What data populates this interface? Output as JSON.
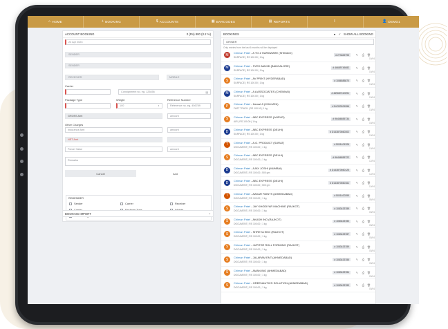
{
  "nav": [
    {
      "icon": "⌂",
      "icon_name": "home-icon",
      "label": "HOME"
    },
    {
      "icon": "+",
      "icon_name": "plus-icon",
      "label": "BOOKING"
    },
    {
      "icon": "$",
      "icon_name": "accounts-icon",
      "label": "ACCOUNTS"
    },
    {
      "icon": "▦",
      "icon_name": "barcode-icon",
      "label": "BARCODES"
    },
    {
      "icon": "▤",
      "icon_name": "reports-icon",
      "label": "REPORTS"
    },
    {
      "icon": "i",
      "icon_name": "info-icon",
      "label": ""
    },
    {
      "icon": "👤",
      "icon_name": "user-icon",
      "label": "DEMO1"
    }
  ],
  "account": {
    "title": "ACCOUNT BOOKING",
    "status": "0 (Rs) 800 (0.2 %)",
    "date": "24 Apr 2023",
    "sender": "SENDER",
    "sender2": "SENDER",
    "receiver": "RECEIVER",
    "mobile": "MOBILE",
    "carrier_label": "Carrier",
    "consignment_ph": "Consignment no. eg. 125456",
    "package_label": "Package Type",
    "weight_label": "Weight",
    "reference_label": "Reference Number",
    "weight_value": "100",
    "reference_ph": "Reference no. eg. 456789",
    "gross_amt": "GROSS Amt",
    "amount_ph": "amount",
    "other_charges": "Other Charges",
    "insurance_ph": "Insurance Amt",
    "net_amt": "NET Amt",
    "parcel_value": "Parcel Value",
    "remarks": "Remarks",
    "cancel": "Cancel",
    "add": "Add",
    "remember": "REMEMBER",
    "chk_sender": "Sender",
    "chk_carrier": "Carrier",
    "chk_receiver": "Receiver",
    "chk_carrier2": "Carrier",
    "chk_package": "Package Type",
    "chk_weight": "Weight",
    "chk_auto": "Auto Consignment",
    "import": "BOOKING IMPORT"
  },
  "bookings": {
    "title": "BOOKINGS",
    "show_all": "SHOW ALL BOOKING",
    "search": "GR/NER",
    "note": "Only entries from the last 6 months will be displayed",
    "rows": [
      {
        "letter": "M",
        "color": "#c0392b",
        "co": "Chiman Patel",
        "name": "A TO Z HARDWARE (SHIMAGI)",
        "sub": "SURFACE | RS 100.00 | 1 kg",
        "awb": "# 273465795",
        "date": "15/04"
      },
      {
        "letter": "M",
        "color": "#1a3a8f",
        "co": "Chiman Patel",
        "name": "SYED MAHID (BANGALORE)",
        "sub": "SURFACE | RS 100.00 | 1 kg",
        "awb": "# 46689745082",
        "date": "15/04"
      },
      {
        "letter": "S",
        "color": "#e67e22",
        "co": "Chiman Patel",
        "name": "AV PRINT (HYDERABAD)",
        "sub": "SURFACE | RS 100.00 | 1 kg",
        "awb": "# 1086585870",
        "date": "13/04"
      },
      {
        "letter": "M",
        "color": "#1a3a8f",
        "co": "Chiman Patel",
        "name": "A A ASSOCIATES (CHENNAI)",
        "sub": "SURFACE | RS 100.00 | 1 kg",
        "awb": "# 469687410091",
        "date": "13/04"
      },
      {
        "letter": "P",
        "color": "#e67e22",
        "co": "Chiman Patel",
        "name": "Kamal Ji (KOLKATA)",
        "sub": "FAST TRACK | RS 100.00 | 1 kg",
        "awb": "# BLR33021556",
        "date": "13/04"
      },
      {
        "letter": "S",
        "color": "#e67e22",
        "co": "Chiman Patel",
        "name": "ABC EXPRESS (JAIPUR)",
        "sub": "AIR | RS 100.00 | 1 kg",
        "awb": "# 96466855734",
        "date": "15/04"
      },
      {
        "letter": "D",
        "color": "#1a3a8f",
        "co": "Chiman Patel",
        "name": "ABC EXPRESS (DELHI)",
        "sub": "SURFACE | RS 100.00 | 1 kg",
        "awb": "# D143870660302",
        "date": "13/04"
      },
      {
        "letter": "T",
        "color": "#d35400",
        "co": "Chiman Patel",
        "name": "A.G. PRODUCT (SURAT)",
        "sub": "DOCUMENT | RS 100.00 | 1 kg",
        "awb": "# 5001401326",
        "date": "13/04"
      },
      {
        "letter": "S",
        "color": "#e67e22",
        "co": "Chiman Patel",
        "name": "ABC EXPRESS (DELHI)",
        "sub": "DOCUMENT | RS 100.00 | 1 kg",
        "awb": "# 96466855722",
        "date": "12/04"
      },
      {
        "letter": "D",
        "color": "#1a3a8f",
        "co": "Chiman Patel",
        "name": "AJAY JOSHI (MUMBAI)",
        "sub": "DOCUMENT | RS 100.00 | 500 gm",
        "awb": "# D143870660125",
        "date": "12/04"
      },
      {
        "letter": "D",
        "color": "#1a3a8f",
        "co": "Chiman Patel",
        "name": "ABC EXPRESS (DELHI)",
        "sub": "DOCUMENT | RS 100.00 | 500 gm",
        "awb": "# D143870660161",
        "date": "10/04"
      },
      {
        "letter": "T",
        "color": "#d35400",
        "co": "Chiman Patel",
        "name": "AAKAR PAINTS (AHMEDABAD)",
        "sub": "DOCUMENT | RS 100.00 | 1 kg",
        "awb": "# 5001400399",
        "date": "05/04"
      },
      {
        "letter": "S",
        "color": "#e67e22",
        "co": "Chiman Patel",
        "name": "JAY KHODIYAR MACHINE (RAJKOT)",
        "sub": "DOCUMENT | RS 100.00 | 1 kg",
        "awb": "# 1083433789",
        "date": "03/04"
      },
      {
        "letter": "S",
        "color": "#e67e22",
        "co": "Chiman Patel",
        "name": "AKASH INO (RAJKOT)",
        "sub": "DOCUMENT | RS 100.00 | 1 kg",
        "awb": "# 1083433780",
        "date": "03/04"
      },
      {
        "letter": "S",
        "color": "#e67e22",
        "co": "Chiman Patel",
        "name": "SHREYA ENG (RAJKOT)",
        "sub": "DOCUMENT | RS 100.00 | 1 kg",
        "awb": "# 1083433787",
        "date": "03/04"
      },
      {
        "letter": "S",
        "color": "#e67e22",
        "co": "Chiman Patel",
        "name": "JUPITER ROLL FORMING (RAJKOT)",
        "sub": "DOCUMENT | RS 100.00 | 1 kg",
        "awb": "# 1083433789",
        "date": "03/04"
      },
      {
        "letter": "S",
        "color": "#e67e22",
        "co": "Chiman Patel",
        "name": "JALARAM ENT (AHMEDABAD)",
        "sub": "DOCUMENT | RS 100.00 | 1 kg",
        "awb": "# 1083433785",
        "date": "03/04"
      },
      {
        "letter": "S",
        "color": "#e67e22",
        "co": "Chiman Patel",
        "name": "AMAN INO (AHMEDABAD)",
        "sub": "DOCUMENT | RS 100.00 | 1 kg",
        "awb": "# 1083433784",
        "date": "03/04"
      },
      {
        "letter": "S",
        "color": "#e67e22",
        "co": "Chiman Patel",
        "name": "GREENAUTICS SOLUTION (AHMEDABAD)",
        "sub": "DOCUMENT | RS 100.00 | 1 kg",
        "awb": "# 1083433783",
        "date": "03/04"
      }
    ]
  }
}
